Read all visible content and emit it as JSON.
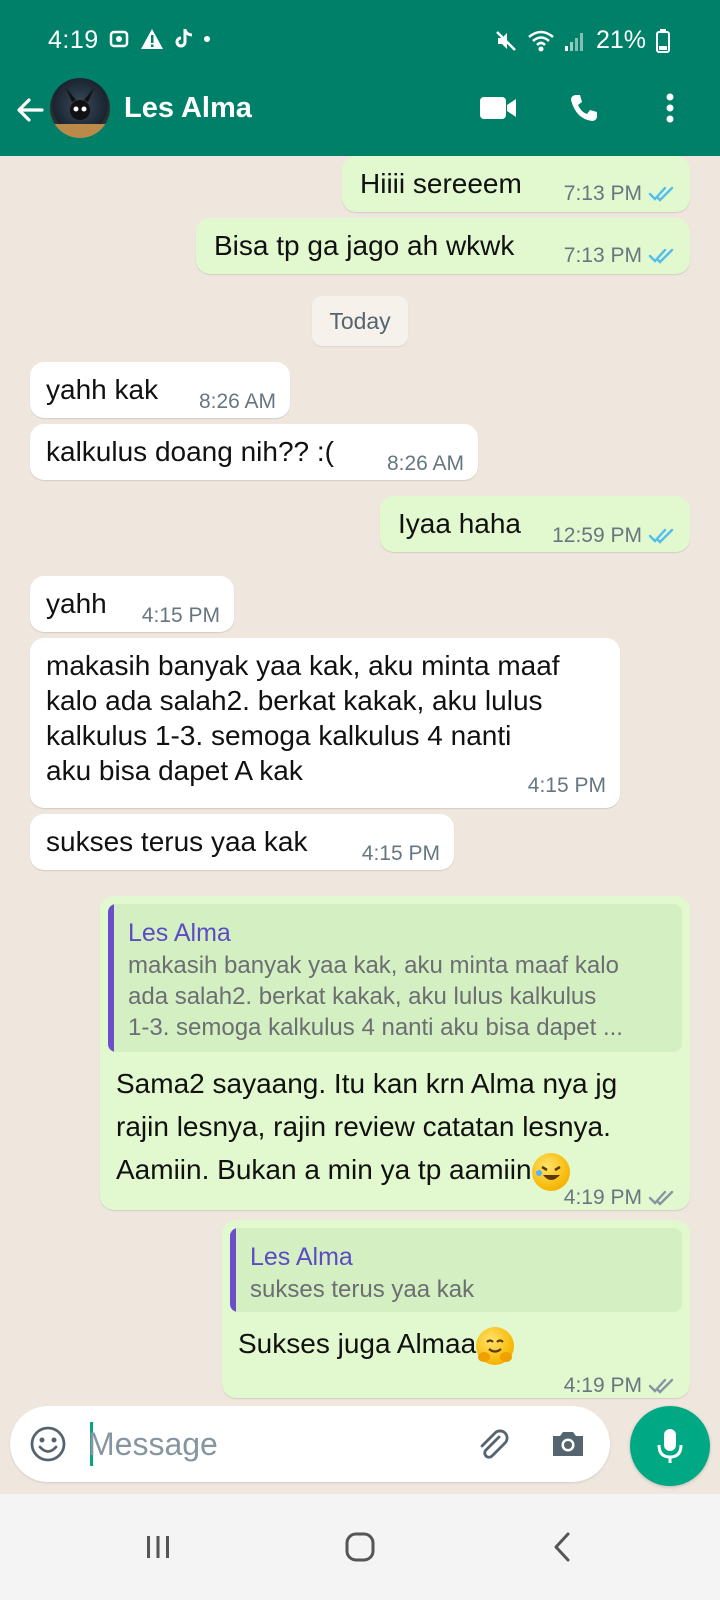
{
  "status_bar": {
    "time": "4:19",
    "battery": "21%"
  },
  "header": {
    "contact_name": "Les Alma"
  },
  "chat": {
    "date_chip": "Today",
    "messages": [
      {
        "dir": "out",
        "text": "Hiiii sereeem",
        "time": "7:13 PM",
        "status": "read"
      },
      {
        "dir": "out",
        "text": "Bisa tp ga jago ah wkwk",
        "time": "7:13 PM",
        "status": "read"
      },
      {
        "dir": "in",
        "text": "yahh kak",
        "time": "8:26 AM"
      },
      {
        "dir": "in",
        "text": "kalkulus doang nih?? :(",
        "time": "8:26 AM"
      },
      {
        "dir": "out",
        "text": "Iyaa haha",
        "time": "12:59 PM",
        "status": "read"
      },
      {
        "dir": "in",
        "text": "yahh",
        "time": "4:15 PM"
      },
      {
        "dir": "in",
        "lines": [
          "makasih banyak yaa kak, aku minta maaf",
          "kalo ada salah2. berkat kakak, aku lulus",
          "kalkulus 1-3. semoga kalkulus 4 nanti",
          "aku bisa dapet A kak"
        ],
        "time": "4:15 PM"
      },
      {
        "dir": "in",
        "text": "sukses terus yaa kak",
        "time": "4:15 PM"
      },
      {
        "dir": "out",
        "quote": {
          "name": "Les Alma",
          "lines": [
            "makasih banyak yaa kak, aku minta maaf kalo",
            "ada salah2. berkat kakak, aku lulus kalkulus",
            "1-3. semoga kalkulus 4 nanti aku bisa dapet ..."
          ]
        },
        "lines": [
          "Sama2 sayaang. Itu kan krn Alma nya jg",
          "rajin lesnya, rajin review catatan lesnya.",
          "Aamiin. Bukan a min ya tp aamiin"
        ],
        "emoji": "rolling-on-the-floor-laughing",
        "time": "4:19 PM",
        "status": "delivered"
      },
      {
        "dir": "out",
        "quote": {
          "name": "Les Alma",
          "lines": [
            "sukses terus yaa kak"
          ]
        },
        "text": "Sukses juga Almaa",
        "emoji": "hugging-face",
        "time": "4:19 PM",
        "status": "delivered"
      }
    ]
  },
  "composer": {
    "placeholder": "Message"
  },
  "colors": {
    "brand": "#008069",
    "accent": "#00a884",
    "outgoing_bubble": "#e2f8cf",
    "incoming_bubble": "#ffffff",
    "read_ticks": "#53bdeb",
    "quote_name": "#5b4cc4"
  },
  "icons": [
    "back-arrow-icon",
    "video-call-icon",
    "voice-call-icon",
    "more-vert-icon",
    "emoji-icon",
    "attach-icon",
    "camera-icon",
    "mic-icon",
    "nav-recents-icon",
    "nav-home-icon",
    "nav-back-icon"
  ]
}
